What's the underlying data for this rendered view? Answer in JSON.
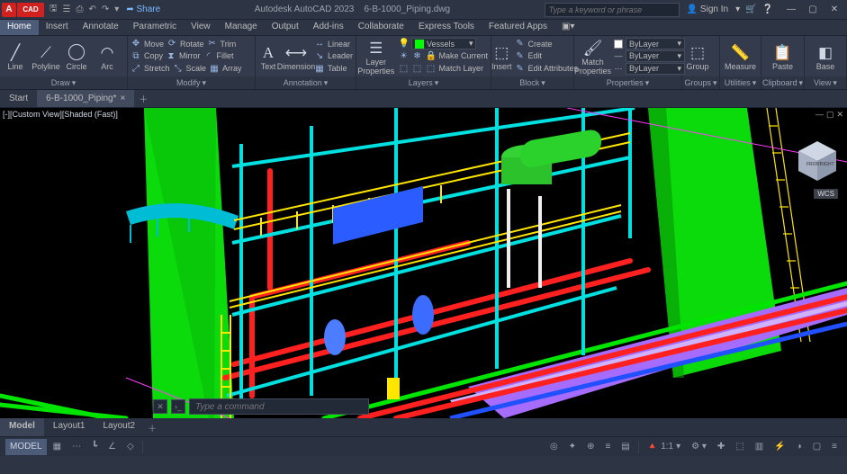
{
  "titlebar": {
    "logo_text_a": "A",
    "logo_text_cad": "CAD",
    "share_label": "Share",
    "app_name": "Autodesk AutoCAD 2023",
    "doc_name": "6-B-1000_Piping.dwg",
    "search_placeholder": "Type a keyword or phrase",
    "signin_label": "Sign In",
    "qat_icons": [
      "save-icon",
      "open-icon",
      "undo-icon",
      "redo-icon",
      "plot-icon"
    ],
    "right_icons": [
      "cart-icon",
      "help-icon"
    ]
  },
  "menu": {
    "tabs": [
      "Home",
      "Insert",
      "Annotate",
      "Parametric",
      "View",
      "Manage",
      "Output",
      "Add-ins",
      "Collaborate",
      "Express Tools",
      "Featured Apps"
    ]
  },
  "ribbon": {
    "draw": {
      "panel": "Draw",
      "line": "Line",
      "polyline": "Polyline",
      "circle": "Circle",
      "arc": "Arc"
    },
    "modify": {
      "panel": "Modify",
      "row1": [
        "Move",
        "Rotate",
        "Trim"
      ],
      "row2": [
        "Copy",
        "Mirror",
        "Fillet"
      ],
      "row3": [
        "Stretch",
        "Scale",
        "Array"
      ]
    },
    "annotation": {
      "panel": "Annotation",
      "text": "Text",
      "dimension": "Dimension",
      "row1": "Linear",
      "row2": "Leader",
      "row3": "Table"
    },
    "layers": {
      "panel": "Layers",
      "properties": "Layer\nProperties",
      "selected": "Vessels",
      "row2": "Make Current",
      "row3": "Match Layer"
    },
    "block": {
      "panel": "Block",
      "insert": "Insert",
      "row1": "Create",
      "row2": "Edit",
      "row3": "Edit Attributes"
    },
    "properties": {
      "panel": "Properties",
      "match": "Match\nProperties",
      "dd1": "ByLayer",
      "dd2": "ByLayer",
      "dd3": "ByLayer"
    },
    "groups": {
      "panel": "Groups",
      "label": "Group"
    },
    "utilities": {
      "panel": "Utilities",
      "label": "Measure"
    },
    "clipboard": {
      "panel": "Clipboard",
      "label": "Paste"
    },
    "view": {
      "panel": "View",
      "label": "Base"
    }
  },
  "doctabs": {
    "start": "Start",
    "active": "6-B-1000_Piping*"
  },
  "viewport": {
    "label": "[-][Custom View][Shaded (Fast)]",
    "wcs": "WCS",
    "cmd_placeholder": "Type a command",
    "cube_front": "FRONT",
    "cube_right": "RIGHT"
  },
  "layout_tabs": [
    "Model",
    "Layout1",
    "Layout2"
  ],
  "status": {
    "model": "MODEL",
    "scale": "1:1"
  }
}
